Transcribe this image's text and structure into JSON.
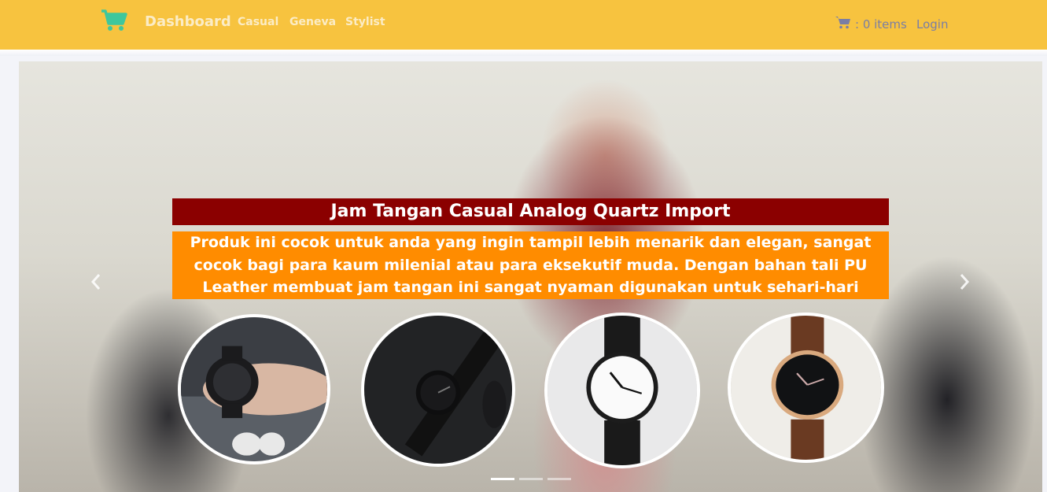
{
  "navbar": {
    "brand_label": "Dashboard",
    "links": [
      "Casual",
      "Geneva",
      "Stylist"
    ],
    "cart_text": ": 0 items",
    "login_label": "Login",
    "brand_icon": "shopping-cart-icon",
    "cart_icon": "cart-icon"
  },
  "carousel": {
    "title": "Jam Tangan Casual Analog Quartz Import",
    "description": "Produk ini cocok untuk anda yang ingin tampil lebih menarik dan elegan, sangat cocok bagi para kaum milenial atau para eksekutif muda. Dengan bahan tali PU Leather membuat jam tangan ini sangat nyaman digunakan untuk sehari-hari",
    "prev_icon": "chevron-left-icon",
    "next_icon": "chevron-right-icon",
    "slide_count": 3,
    "active_slide": 1
  },
  "colors": {
    "navbar_bg": "#f7c33f",
    "brand_icon": "#3fc79c",
    "title_bg": "#8b0000",
    "description_bg": "#ff8c00",
    "nav_link": "#fbecc6",
    "cart_text": "#7a7ea5"
  }
}
